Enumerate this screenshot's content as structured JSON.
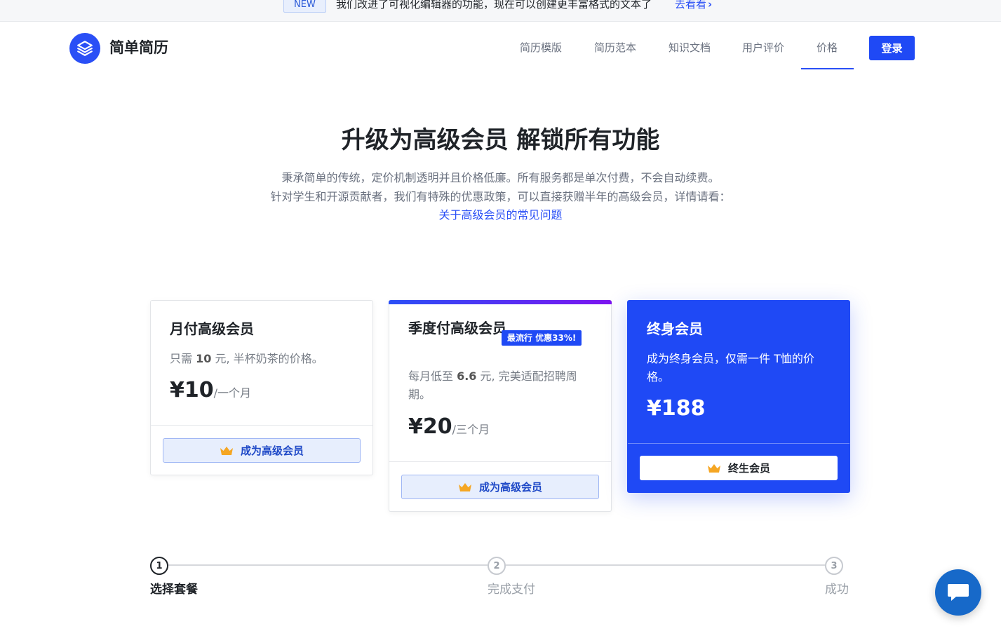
{
  "announcement": {
    "badge": "NEW",
    "message": "我们改进了可视化编辑器的功能，现在可以创建更丰富格式的文本了",
    "link": "去看看"
  },
  "header": {
    "brand": "简单简历",
    "nav": [
      "简历模版",
      "简历范本",
      "知识文档",
      "用户评价",
      "价格"
    ],
    "active_nav": "价格",
    "login": "登录"
  },
  "hero": {
    "title": "升级为高级会员 解锁所有功能",
    "line1": "秉承简单的传统，定价机制透明并且价格低廉。所有服务都是单次付费，不会自动续费。",
    "line2": "针对学生和开源贡献者，我们有特殊的优惠政策，可以直接获赠半年的高级会员，详情请看：",
    "link": "关于高级会员的常见问题"
  },
  "plans": [
    {
      "name": "月付高级会员",
      "desc_pre": "只需 ",
      "desc_num": "10",
      "desc_post": " 元, 半杯奶茶的价格。",
      "price": "¥10",
      "period": "/一个月",
      "cta": "成为高级会员"
    },
    {
      "name": "季度付高级会员",
      "badge": "最流行 优惠33%!",
      "desc_pre": "每月低至 ",
      "desc_num": "6.6",
      "desc_post": " 元, 完美适配招聘周期。",
      "price": "¥20",
      "period": "/三个月",
      "cta": "成为高级会员"
    },
    {
      "name": "终身会员",
      "desc": "成为终身会员，仅需一件 T恤的价格。",
      "price": "¥188",
      "cta": "终生会员"
    }
  ],
  "steps": [
    {
      "num": "1",
      "label": "选择套餐"
    },
    {
      "num": "2",
      "label": "完成支付"
    },
    {
      "num": "3",
      "label": "成功"
    }
  ],
  "colors": {
    "primary": "#1f49f5",
    "crown": "#f5a623"
  }
}
